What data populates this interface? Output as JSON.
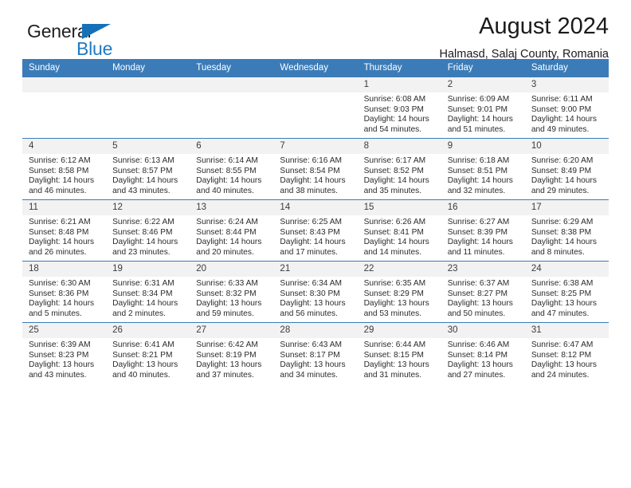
{
  "brand": {
    "name_line1": "General",
    "name_line2": "Blue",
    "logo_triangle_color": "#1670b8",
    "blue_text_color": "#1f7ac4"
  },
  "header": {
    "title": "August 2024",
    "subtitle": "Halmasd, Salaj County, Romania",
    "header_bg_color": "#3b7cb8",
    "daynum_bg_color": "#f2f2f2"
  },
  "weekday_headers": [
    "Sunday",
    "Monday",
    "Tuesday",
    "Wednesday",
    "Thursday",
    "Friday",
    "Saturday"
  ],
  "labels": {
    "sunrise_prefix": "Sunrise: ",
    "sunset_prefix": "Sunset: ",
    "daylight_prefix": "Daylight: "
  },
  "weeks": [
    [
      {
        "day": "",
        "sunrise": "",
        "sunset": "",
        "daylight": "",
        "empty": true
      },
      {
        "day": "",
        "sunrise": "",
        "sunset": "",
        "daylight": "",
        "empty": true
      },
      {
        "day": "",
        "sunrise": "",
        "sunset": "",
        "daylight": "",
        "empty": true
      },
      {
        "day": "",
        "sunrise": "",
        "sunset": "",
        "daylight": "",
        "empty": true
      },
      {
        "day": "1",
        "sunrise": "Sunrise: 6:08 AM",
        "sunset": "Sunset: 9:03 PM",
        "daylight": "Daylight: 14 hours and 54 minutes."
      },
      {
        "day": "2",
        "sunrise": "Sunrise: 6:09 AM",
        "sunset": "Sunset: 9:01 PM",
        "daylight": "Daylight: 14 hours and 51 minutes."
      },
      {
        "day": "3",
        "sunrise": "Sunrise: 6:11 AM",
        "sunset": "Sunset: 9:00 PM",
        "daylight": "Daylight: 14 hours and 49 minutes."
      }
    ],
    [
      {
        "day": "4",
        "sunrise": "Sunrise: 6:12 AM",
        "sunset": "Sunset: 8:58 PM",
        "daylight": "Daylight: 14 hours and 46 minutes."
      },
      {
        "day": "5",
        "sunrise": "Sunrise: 6:13 AM",
        "sunset": "Sunset: 8:57 PM",
        "daylight": "Daylight: 14 hours and 43 minutes."
      },
      {
        "day": "6",
        "sunrise": "Sunrise: 6:14 AM",
        "sunset": "Sunset: 8:55 PM",
        "daylight": "Daylight: 14 hours and 40 minutes."
      },
      {
        "day": "7",
        "sunrise": "Sunrise: 6:16 AM",
        "sunset": "Sunset: 8:54 PM",
        "daylight": "Daylight: 14 hours and 38 minutes."
      },
      {
        "day": "8",
        "sunrise": "Sunrise: 6:17 AM",
        "sunset": "Sunset: 8:52 PM",
        "daylight": "Daylight: 14 hours and 35 minutes."
      },
      {
        "day": "9",
        "sunrise": "Sunrise: 6:18 AM",
        "sunset": "Sunset: 8:51 PM",
        "daylight": "Daylight: 14 hours and 32 minutes."
      },
      {
        "day": "10",
        "sunrise": "Sunrise: 6:20 AM",
        "sunset": "Sunset: 8:49 PM",
        "daylight": "Daylight: 14 hours and 29 minutes."
      }
    ],
    [
      {
        "day": "11",
        "sunrise": "Sunrise: 6:21 AM",
        "sunset": "Sunset: 8:48 PM",
        "daylight": "Daylight: 14 hours and 26 minutes."
      },
      {
        "day": "12",
        "sunrise": "Sunrise: 6:22 AM",
        "sunset": "Sunset: 8:46 PM",
        "daylight": "Daylight: 14 hours and 23 minutes."
      },
      {
        "day": "13",
        "sunrise": "Sunrise: 6:24 AM",
        "sunset": "Sunset: 8:44 PM",
        "daylight": "Daylight: 14 hours and 20 minutes."
      },
      {
        "day": "14",
        "sunrise": "Sunrise: 6:25 AM",
        "sunset": "Sunset: 8:43 PM",
        "daylight": "Daylight: 14 hours and 17 minutes."
      },
      {
        "day": "15",
        "sunrise": "Sunrise: 6:26 AM",
        "sunset": "Sunset: 8:41 PM",
        "daylight": "Daylight: 14 hours and 14 minutes."
      },
      {
        "day": "16",
        "sunrise": "Sunrise: 6:27 AM",
        "sunset": "Sunset: 8:39 PM",
        "daylight": "Daylight: 14 hours and 11 minutes."
      },
      {
        "day": "17",
        "sunrise": "Sunrise: 6:29 AM",
        "sunset": "Sunset: 8:38 PM",
        "daylight": "Daylight: 14 hours and 8 minutes."
      }
    ],
    [
      {
        "day": "18",
        "sunrise": "Sunrise: 6:30 AM",
        "sunset": "Sunset: 8:36 PM",
        "daylight": "Daylight: 14 hours and 5 minutes."
      },
      {
        "day": "19",
        "sunrise": "Sunrise: 6:31 AM",
        "sunset": "Sunset: 8:34 PM",
        "daylight": "Daylight: 14 hours and 2 minutes."
      },
      {
        "day": "20",
        "sunrise": "Sunrise: 6:33 AM",
        "sunset": "Sunset: 8:32 PM",
        "daylight": "Daylight: 13 hours and 59 minutes."
      },
      {
        "day": "21",
        "sunrise": "Sunrise: 6:34 AM",
        "sunset": "Sunset: 8:30 PM",
        "daylight": "Daylight: 13 hours and 56 minutes."
      },
      {
        "day": "22",
        "sunrise": "Sunrise: 6:35 AM",
        "sunset": "Sunset: 8:29 PM",
        "daylight": "Daylight: 13 hours and 53 minutes."
      },
      {
        "day": "23",
        "sunrise": "Sunrise: 6:37 AM",
        "sunset": "Sunset: 8:27 PM",
        "daylight": "Daylight: 13 hours and 50 minutes."
      },
      {
        "day": "24",
        "sunrise": "Sunrise: 6:38 AM",
        "sunset": "Sunset: 8:25 PM",
        "daylight": "Daylight: 13 hours and 47 minutes."
      }
    ],
    [
      {
        "day": "25",
        "sunrise": "Sunrise: 6:39 AM",
        "sunset": "Sunset: 8:23 PM",
        "daylight": "Daylight: 13 hours and 43 minutes."
      },
      {
        "day": "26",
        "sunrise": "Sunrise: 6:41 AM",
        "sunset": "Sunset: 8:21 PM",
        "daylight": "Daylight: 13 hours and 40 minutes."
      },
      {
        "day": "27",
        "sunrise": "Sunrise: 6:42 AM",
        "sunset": "Sunset: 8:19 PM",
        "daylight": "Daylight: 13 hours and 37 minutes."
      },
      {
        "day": "28",
        "sunrise": "Sunrise: 6:43 AM",
        "sunset": "Sunset: 8:17 PM",
        "daylight": "Daylight: 13 hours and 34 minutes."
      },
      {
        "day": "29",
        "sunrise": "Sunrise: 6:44 AM",
        "sunset": "Sunset: 8:15 PM",
        "daylight": "Daylight: 13 hours and 31 minutes."
      },
      {
        "day": "30",
        "sunrise": "Sunrise: 6:46 AM",
        "sunset": "Sunset: 8:14 PM",
        "daylight": "Daylight: 13 hours and 27 minutes."
      },
      {
        "day": "31",
        "sunrise": "Sunrise: 6:47 AM",
        "sunset": "Sunset: 8:12 PM",
        "daylight": "Daylight: 13 hours and 24 minutes."
      }
    ]
  ]
}
